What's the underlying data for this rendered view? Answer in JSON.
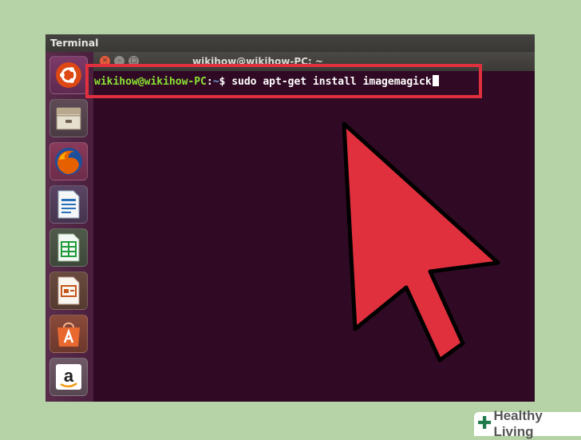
{
  "screen": {
    "topbar_title": "Terminal"
  },
  "window": {
    "title": "wikihow@wikihow-PC: ~",
    "close_glyph": "×",
    "minimize_glyph": "–",
    "maximize_glyph": "□"
  },
  "terminal": {
    "user_host": "wikihow@wikihow-PC",
    "colon": ":",
    "path": "~",
    "prompt_symbol": "$",
    "command": "sudo apt-get install imagemagick"
  },
  "launcher": {
    "items": [
      {
        "icon": "ubuntu-dash-icon",
        "color": "#dd4814"
      },
      {
        "icon": "files-icon",
        "color": "#c9b79c"
      },
      {
        "icon": "firefox-icon",
        "color": "#e66000"
      },
      {
        "icon": "writer-icon",
        "color": "#2a70b8"
      },
      {
        "icon": "calc-icon",
        "color": "#1e9b3b"
      },
      {
        "icon": "impress-icon",
        "color": "#c5561a"
      },
      {
        "icon": "software-center-icon",
        "color": "#e9682f"
      },
      {
        "icon": "amazon-icon",
        "color": "#ffffff"
      }
    ]
  },
  "annotation": {
    "highlight_color": "#e0303e",
    "arrow_color": "#e0303e"
  },
  "brand": {
    "icon_glyph": "✚",
    "name": "Healthy Living"
  }
}
